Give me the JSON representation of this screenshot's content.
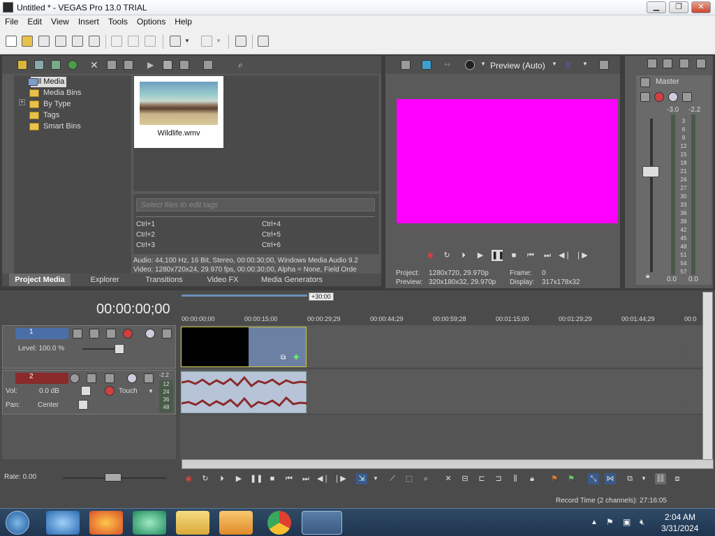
{
  "window": {
    "title": "Untitled * - VEGAS Pro 13.0 TRIAL",
    "minimize": "▁",
    "maximize": "❐",
    "close": "✕"
  },
  "menu": [
    "File",
    "Edit",
    "View",
    "Insert",
    "Tools",
    "Options",
    "Help"
  ],
  "media": {
    "tree": [
      "All Media",
      "Media Bins",
      "By Type",
      "Tags",
      "Smart Bins"
    ],
    "expander": "+",
    "file_name": "Wildlife.wmv",
    "tags_placeholder": "Select files to edit tags",
    "shortcuts": [
      "Ctrl+1",
      "Ctrl+2",
      "Ctrl+3",
      "Ctrl+4",
      "Ctrl+5",
      "Ctrl+6"
    ],
    "audio_info": "Audio: 44,100 Hz, 16 Bit, Stereo, 00:00:30;00, Windows Media Audio 9.2",
    "video_info": "Video: 1280x720x24, 29.970 fps, 00:00:30;00, Alpha = None, Field Orde",
    "tabs": [
      "Project Media",
      "Explorer",
      "Transitions",
      "Video FX",
      "Media Generators"
    ]
  },
  "preview": {
    "mode": "Preview (Auto)",
    "frame_color": "#ff00ff",
    "project_label": "Project:",
    "project_value": "1280x720, 29.970p",
    "preview_label": "Preview:",
    "preview_value": "320x180x32, 29.970p",
    "frame_label": "Frame:",
    "frame_value": "0",
    "display_label": "Display:",
    "display_value": "317x178x32"
  },
  "master": {
    "label": "Master",
    "peak_left": "-3.0",
    "peak_right": "-2.2",
    "scale": [
      "3",
      "6",
      "9",
      "12",
      "15",
      "18",
      "21",
      "24",
      "27",
      "30",
      "33",
      "36",
      "39",
      "42",
      "45",
      "48",
      "51",
      "54",
      "57"
    ],
    "bottom_left": "0.0",
    "bottom_right": "0.0"
  },
  "timeline": {
    "time": "00:00:00;00",
    "loop_label": "+30:00",
    "ruler": [
      "00:00:00;00",
      "00:00:15;00",
      "00:00:29;29",
      "00:00:44;29",
      "00:00:59;28",
      "00:01:15;00",
      "00:01:29;29",
      "00:01:44;29",
      "00:0"
    ],
    "video_track": {
      "number": "1",
      "level_label": "Level: 100.0 %"
    },
    "audio_track": {
      "number": "2",
      "vol_label": "Vol:",
      "vol_value": "0.0 dB",
      "pan_label": "Pan:",
      "pan_value": "Center",
      "mode": "Touch",
      "meter_top": "-2.2",
      "meter_scale": [
        "12",
        "24",
        "36",
        "48"
      ]
    },
    "rate": "Rate: 0.00",
    "record_time": "Record Time (2 channels): 27:16:05"
  },
  "taskbar": {
    "time": "2:04 AM",
    "date": "3/31/2024"
  }
}
